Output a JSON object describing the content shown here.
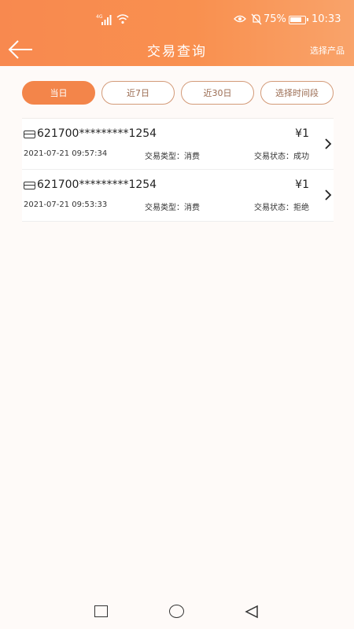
{
  "status_bar": {
    "network": "4G",
    "battery": "75%",
    "time": "10:33"
  },
  "header": {
    "title": "交易查询",
    "select_product": "选择产品"
  },
  "filters": [
    {
      "label": "当日",
      "active": true
    },
    {
      "label": "近7日",
      "active": false
    },
    {
      "label": "近30日",
      "active": false
    },
    {
      "label": "选择时间段",
      "active": false
    }
  ],
  "transactions": [
    {
      "card": "621700*********1254",
      "amount": "¥1",
      "datetime": "2021-07-21 09:57:34",
      "type": "交易类型：消费",
      "status": "交易状态：成功"
    },
    {
      "card": "621700*********1254",
      "amount": "¥1",
      "datetime": "2021-07-21 09:53:33",
      "type": "交易类型：消费",
      "status": "交易状态：拒绝"
    }
  ],
  "colors": {
    "accent": "#f3854a",
    "header_gradient_start": "#f8894f",
    "header_gradient_end": "#f9a36a"
  }
}
